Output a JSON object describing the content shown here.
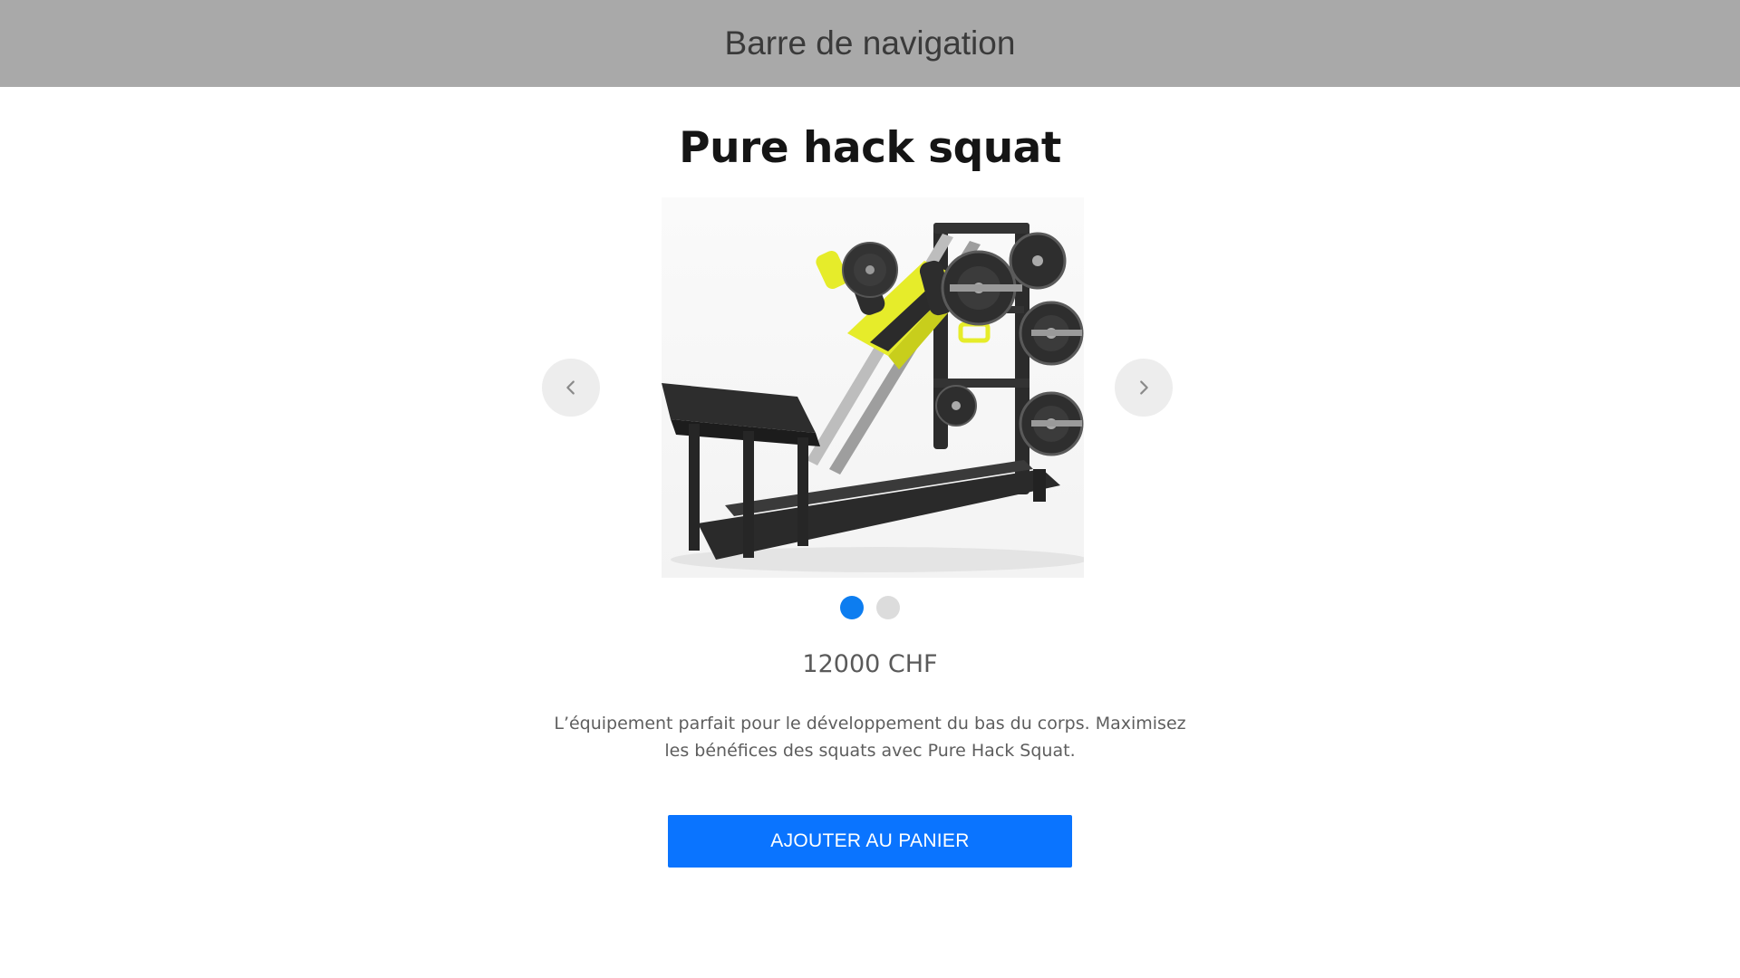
{
  "navbar": {
    "title": "Barre de navigation"
  },
  "product": {
    "title": "Pure hack squat",
    "image_alt": "Pure hack squat machine",
    "price": "12000 CHF",
    "description": "L’équipement parfait pour le développement du bas du corps. Maximisez les bénéfices des squats avec Pure Hack Squat."
  },
  "carousel": {
    "prev_icon": "chevron-left-icon",
    "next_icon": "chevron-right-icon",
    "slide_count": 2,
    "active_index": 0
  },
  "actions": {
    "add_to_cart_label": "AJOUTER AU PANIER"
  },
  "colors": {
    "navbar_bg": "#a9a9a9",
    "accent": "#0a74ff",
    "dot_active": "#0d7df0",
    "dot_inactive": "#dcdcdc",
    "machine_yellow": "#e6ec2a"
  }
}
